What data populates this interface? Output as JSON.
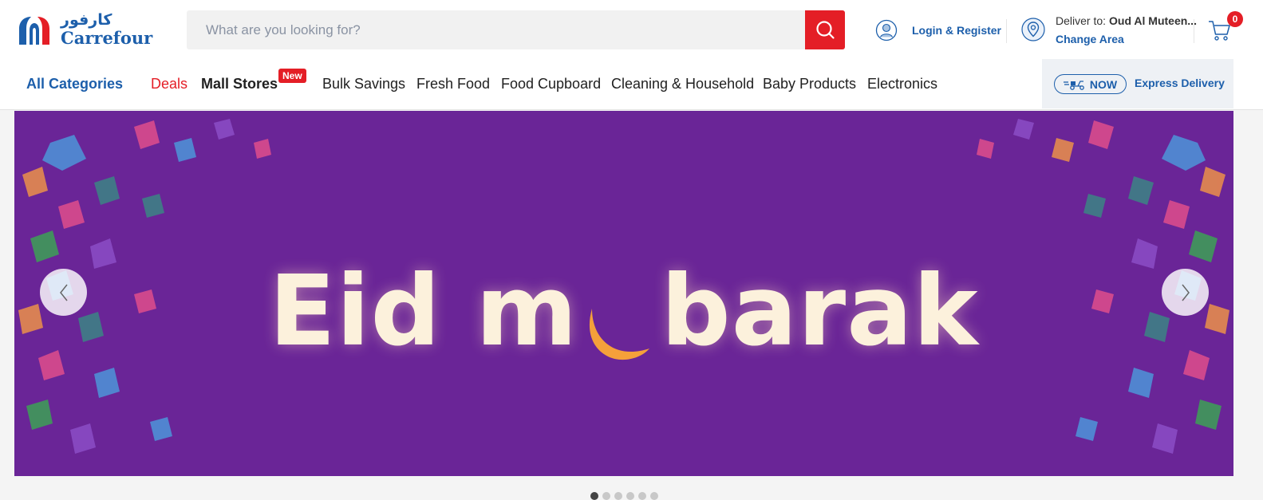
{
  "brand": {
    "name_ar": "كارفور",
    "name_en": "Carrefour",
    "color": "#1d5fab",
    "accent": "#e41e26"
  },
  "search": {
    "placeholder": "What are you looking for?",
    "value": "",
    "icon": "search-icon"
  },
  "account": {
    "login_label": "Login & Register",
    "icon": "user-icon"
  },
  "delivery": {
    "prefix": "Deliver to:",
    "location": "Oud Al Muteen...",
    "change_label": "Change Area",
    "icon": "location-pin-icon"
  },
  "cart": {
    "count": "0",
    "icon": "cart-icon"
  },
  "nav": {
    "all_categories": "All Categories",
    "items": [
      {
        "label": "Deals"
      },
      {
        "label": "Mall Stores",
        "badge": "New"
      },
      {
        "label": "Bulk Savings"
      },
      {
        "label": "Fresh Food"
      },
      {
        "label": "Food Cupboard"
      },
      {
        "label": "Cleaning & Household"
      },
      {
        "label": "Baby Products"
      },
      {
        "label": "Electronics"
      }
    ]
  },
  "express": {
    "now_label": "NOW",
    "label": "Express Delivery",
    "icon": "scooter-icon"
  },
  "banner": {
    "text_left": "Eid m",
    "text_right": "barak",
    "background": "#6a2597",
    "moon_color": "#f5a03a",
    "slide_count": 6,
    "active_slide": 1
  }
}
